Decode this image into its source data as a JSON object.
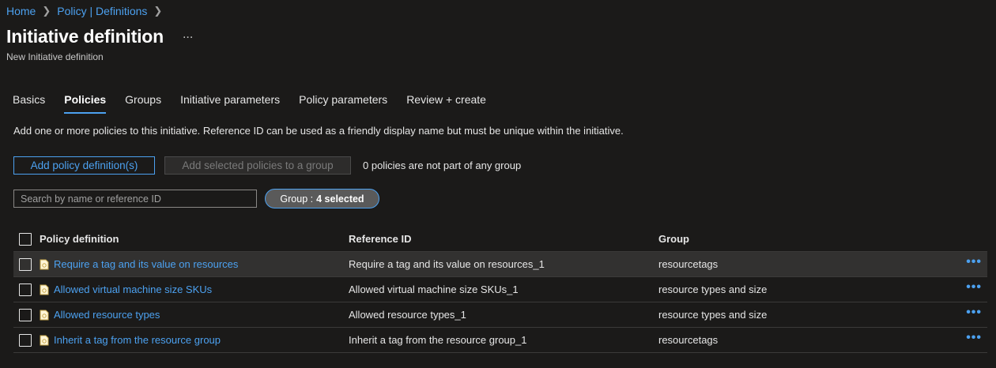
{
  "breadcrumb": [
    {
      "label": "Home"
    },
    {
      "label": "Policy | Definitions"
    }
  ],
  "header": {
    "title": "Initiative definition",
    "more": "...",
    "subtitle": "New Initiative definition"
  },
  "tabs": [
    {
      "label": "Basics",
      "active": false
    },
    {
      "label": "Policies",
      "active": true
    },
    {
      "label": "Groups",
      "active": false
    },
    {
      "label": "Initiative parameters",
      "active": false
    },
    {
      "label": "Policy parameters",
      "active": false
    },
    {
      "label": "Review + create",
      "active": false
    }
  ],
  "description": "Add one or more policies to this initiative. Reference ID can be used as a friendly display name but must be unique within the initiative.",
  "actions": {
    "add_label": "Add policy definition(s)",
    "add_group_label": "Add selected policies to a group",
    "ungrouped_text": "0 policies are not part of any group"
  },
  "search": {
    "placeholder": "Search by name or reference ID",
    "value": ""
  },
  "filter": {
    "label": "Group : ",
    "value": "4 selected"
  },
  "table": {
    "headers": [
      "Policy definition",
      "Reference ID",
      "Group"
    ],
    "rows": [
      {
        "policy": "Require a tag and its value on resources",
        "ref": "Require a tag and its value on resources_1",
        "group": "resourcetags"
      },
      {
        "policy": "Allowed virtual machine size SKUs",
        "ref": "Allowed virtual machine size SKUs_1",
        "group": "resource types and size"
      },
      {
        "policy": "Allowed resource types",
        "ref": "Allowed resource types_1",
        "group": "resource types and size"
      },
      {
        "policy": "Inherit a tag from the resource group",
        "ref": "Inherit a tag from the resource group_1",
        "group": "resourcetags"
      }
    ],
    "row_more": "•••"
  },
  "colors": {
    "accent": "#4ca1f0",
    "background": "#1b1a19",
    "selected_row": "#323130"
  },
  "icons": [
    "chevron-right-icon",
    "more-icon",
    "policy-icon"
  ]
}
